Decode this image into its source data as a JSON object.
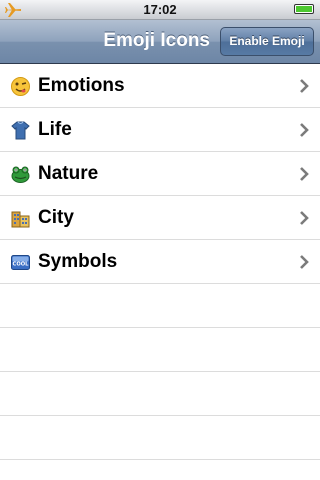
{
  "status": {
    "time": "17:02",
    "battery_level": 1.0,
    "airplane_icon": "airplane-icon",
    "battery_color": "#4cc82f"
  },
  "navbar": {
    "title": "Emoji Icons",
    "button_label": "Enable Emoji"
  },
  "list": {
    "items": [
      {
        "label": "Emotions",
        "icon": "winking-face-emoji-icon"
      },
      {
        "label": "Life",
        "icon": "shirt-emoji-icon"
      },
      {
        "label": "Nature",
        "icon": "frog-emoji-icon"
      },
      {
        "label": "City",
        "icon": "buildings-emoji-icon"
      },
      {
        "label": "Symbols",
        "icon": "cool-sign-emoji-icon"
      }
    ]
  },
  "colors": {
    "navbar": "#6d86a6",
    "separator": "#dcdcdc"
  }
}
